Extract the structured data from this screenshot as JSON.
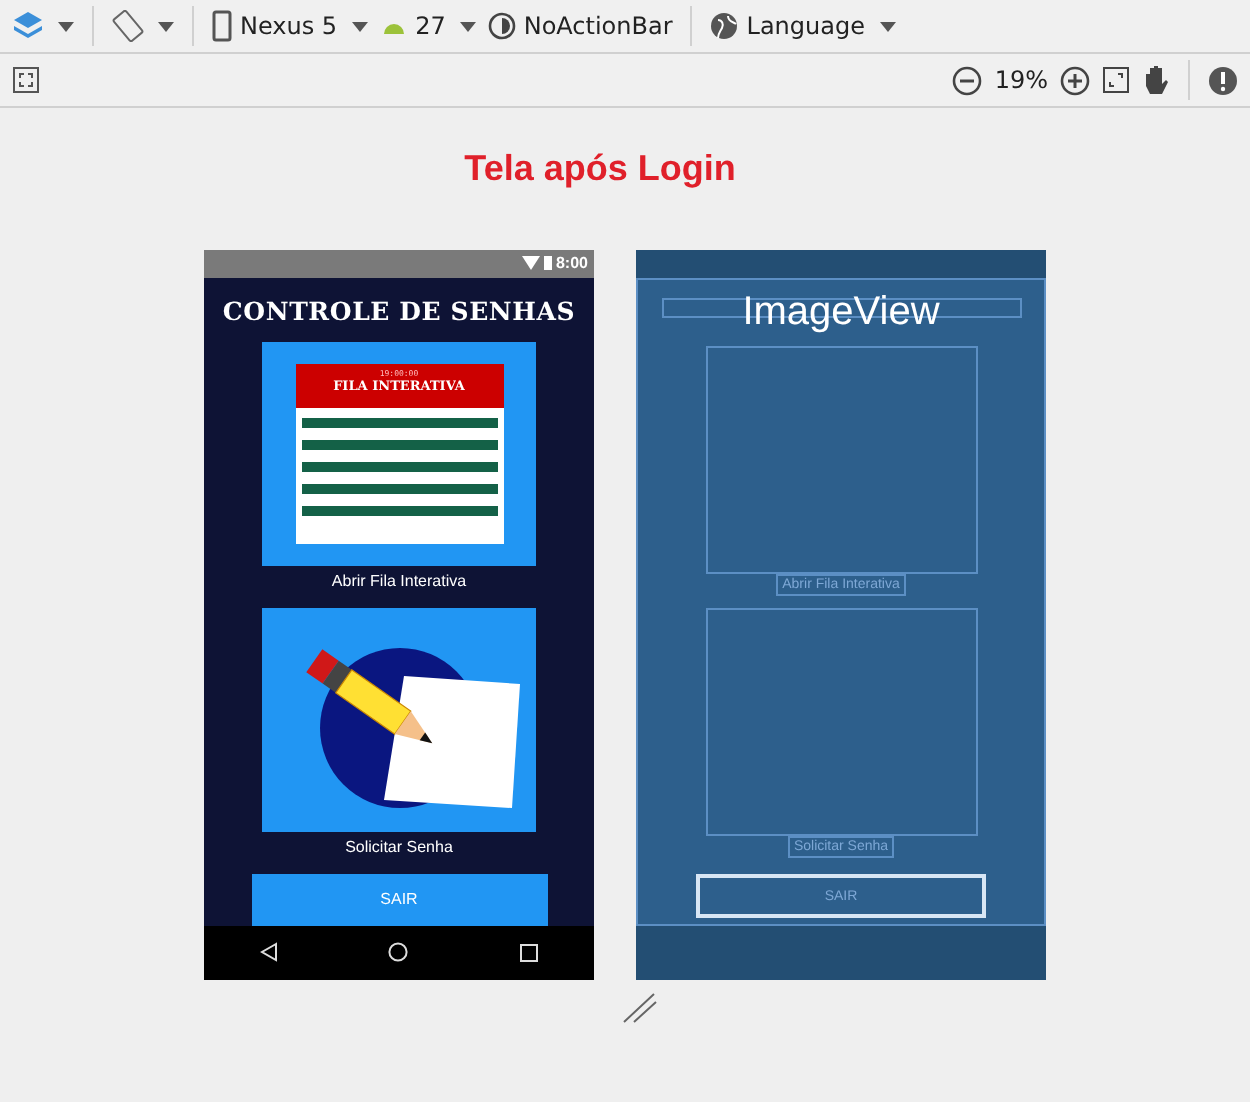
{
  "toolbar": {
    "device": "Nexus 5",
    "api_level": "27",
    "theme": "NoActionBar",
    "locale": "Language",
    "zoom": "19%"
  },
  "title": "Tela após Login",
  "phone": {
    "status_time": "8:00",
    "app_title": "CONTROLE DE SENHAS",
    "queue_image": {
      "time": "19:00:00",
      "header": "FILA INTERATIVA"
    },
    "tiles": [
      {
        "kind": "queue",
        "label": "Abrir Fila Interativa"
      },
      {
        "kind": "pencil",
        "label": "Solicitar Senha"
      }
    ],
    "exit_button": "SAIR"
  },
  "blueprint": {
    "hover_label": "ImageView",
    "labels": [
      "Abrir Fila Interativa",
      "Solicitar Senha"
    ],
    "exit_button": "SAIR"
  }
}
